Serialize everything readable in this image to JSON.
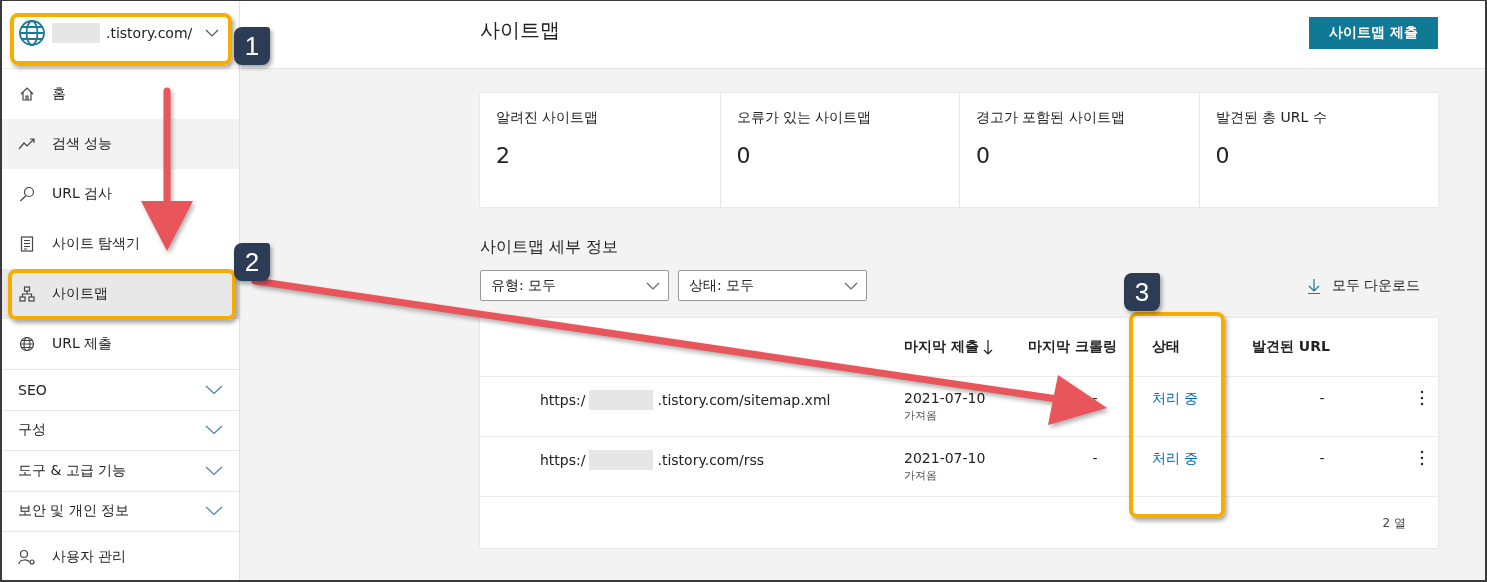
{
  "sidebar": {
    "site": {
      "url": ".tistory.com/"
    },
    "items": [
      {
        "kind": "link",
        "label": "홈",
        "selected": false,
        "hovered": false
      },
      {
        "kind": "link",
        "label": "검색 성능",
        "selected": false,
        "hovered": true
      },
      {
        "kind": "link",
        "label": "URL 검사",
        "selected": false,
        "hovered": false
      },
      {
        "kind": "link",
        "label": "사이트 탐색기",
        "selected": false,
        "hovered": false
      },
      {
        "kind": "link",
        "label": "사이트맵",
        "selected": true,
        "hovered": false
      },
      {
        "kind": "link",
        "label": "URL 제출",
        "selected": false,
        "hovered": false
      },
      {
        "kind": "group",
        "label": "SEO",
        "expanded": false
      },
      {
        "kind": "group",
        "label": "구성",
        "expanded": false
      },
      {
        "kind": "group",
        "label": "도구 & 고급 기능",
        "expanded": false
      },
      {
        "kind": "group",
        "label": "보안 및 개인 정보",
        "expanded": false
      },
      {
        "kind": "link",
        "label": "사용자 관리",
        "selected": false,
        "hovered": false
      }
    ]
  },
  "header": {
    "title": "사이트맵",
    "button": "사이트맵 제출"
  },
  "stats": [
    {
      "label": "알려진 사이트맵",
      "value": "2"
    },
    {
      "label": "오류가 있는 사이트맵",
      "value": "0"
    },
    {
      "label": "경고가 포함된 사이트맵",
      "value": "0"
    },
    {
      "label": "발견된 총 URL 수",
      "value": "0"
    }
  ],
  "details": {
    "title": "사이트맵 세부 정보",
    "filters": [
      {
        "value": "유형: 모두"
      },
      {
        "value": "상태: 모두"
      }
    ],
    "download": "모두 다운로드"
  },
  "table": {
    "columns": [
      {
        "label": "마지막 제출",
        "sorted": true
      },
      {
        "label": "마지막 크롤링",
        "sorted": false
      },
      {
        "label": "상태",
        "sorted": false
      },
      {
        "label": "발견된 URL",
        "sorted": false
      }
    ],
    "rows": [
      {
        "url_start": "https:/",
        "url_end": ".tistory.com/sitemap.xml",
        "submitted": "2021-07-10",
        "note": "가져옴",
        "crawled": "-",
        "status": "처리 중",
        "discovered": "-"
      },
      {
        "url_start": "https:/",
        "url_end": ".tistory.com/rss",
        "submitted": "2021-07-10",
        "note": "가져옴",
        "crawled": "-",
        "status": "처리 중",
        "discovered": "-"
      }
    ],
    "footer": "2 열"
  },
  "annotations": {
    "callouts": [
      {
        "number": "1"
      },
      {
        "number": "2"
      },
      {
        "number": "3"
      }
    ]
  }
}
